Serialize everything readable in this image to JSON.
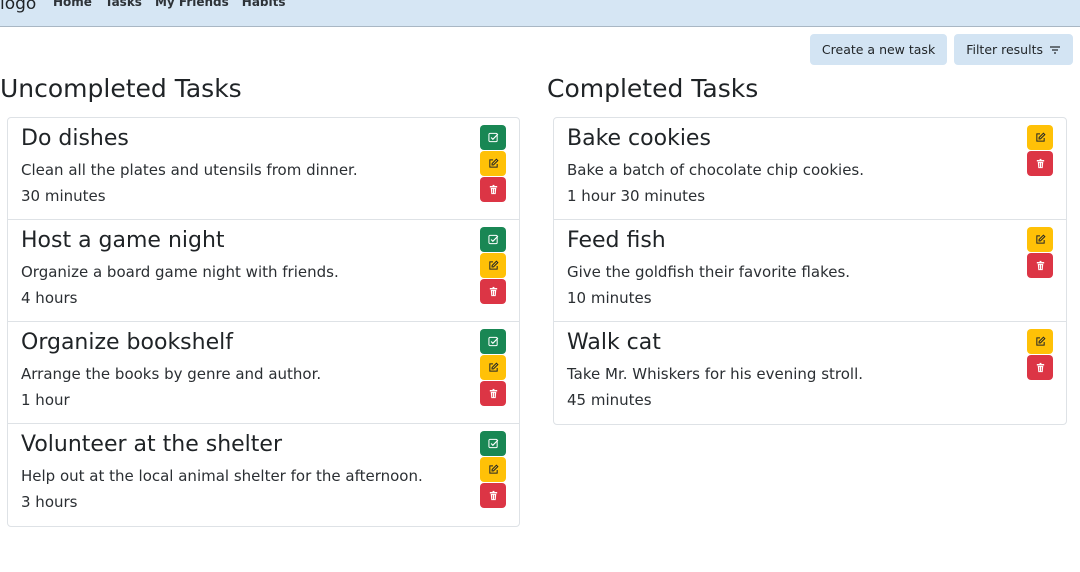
{
  "nav": {
    "logo": "logo",
    "links": [
      "Home",
      "Tasks",
      "My Friends",
      "Habits"
    ]
  },
  "toolbar": {
    "create_label": "Create a new task",
    "filter_label": "Filter results"
  },
  "uncompleted": {
    "heading": "Uncompleted Tasks",
    "tasks": [
      {
        "title": "Do dishes",
        "description": "Clean all the plates and utensils from dinner.",
        "duration": "30 minutes"
      },
      {
        "title": "Host a game night",
        "description": "Organize a board game night with friends.",
        "duration": "4 hours"
      },
      {
        "title": "Organize bookshelf",
        "description": "Arrange the books by genre and author.",
        "duration": "1 hour"
      },
      {
        "title": "Volunteer at the shelter",
        "description": "Help out at the local animal shelter for the afternoon.",
        "duration": "3 hours"
      }
    ]
  },
  "completed": {
    "heading": "Completed Tasks",
    "tasks": [
      {
        "title": "Bake cookies",
        "description": "Bake a batch of chocolate chip cookies.",
        "duration": "1 hour 30 minutes"
      },
      {
        "title": "Feed fish",
        "description": "Give the goldfish their favorite flakes.",
        "duration": "10 minutes"
      },
      {
        "title": "Walk cat",
        "description": "Take Mr. Whiskers for his evening stroll.",
        "duration": "45 minutes"
      }
    ]
  },
  "colors": {
    "complete": "#198754",
    "edit": "#ffc107",
    "delete": "#dc3545",
    "navbar": "#d6e6f4"
  }
}
